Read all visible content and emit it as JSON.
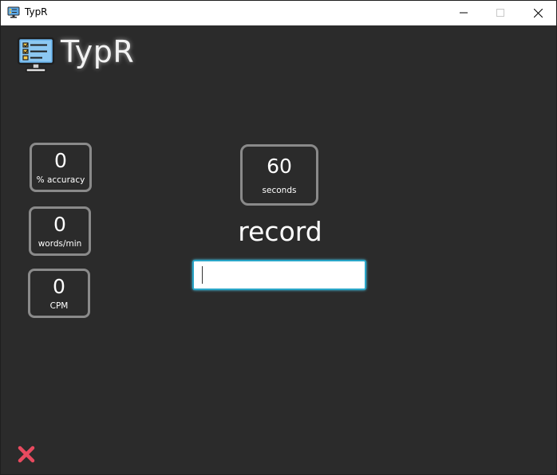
{
  "window": {
    "title": "TypR",
    "controls": {
      "minimize_icon": "minimize-icon",
      "maximize_icon": "maximize-icon",
      "close_icon": "close-icon"
    }
  },
  "header": {
    "logo_text": "TypR",
    "logo_icon": "monitor-checklist-icon"
  },
  "stats": {
    "accuracy": {
      "value": "0",
      "label": "% accuracy"
    },
    "wpm": {
      "value": "0",
      "label": "words/min"
    },
    "cpm": {
      "value": "0",
      "label": "CPM"
    }
  },
  "timer": {
    "value": "60",
    "label": "seconds"
  },
  "current_word": "record",
  "input": {
    "value": "",
    "placeholder": ""
  },
  "exit": {
    "icon": "red-x-icon"
  },
  "colors": {
    "background": "#2b2b2b",
    "box_border": "#8a8a8a",
    "input_focus": "#2aa6c8",
    "exit_red": "#e84a5f"
  }
}
